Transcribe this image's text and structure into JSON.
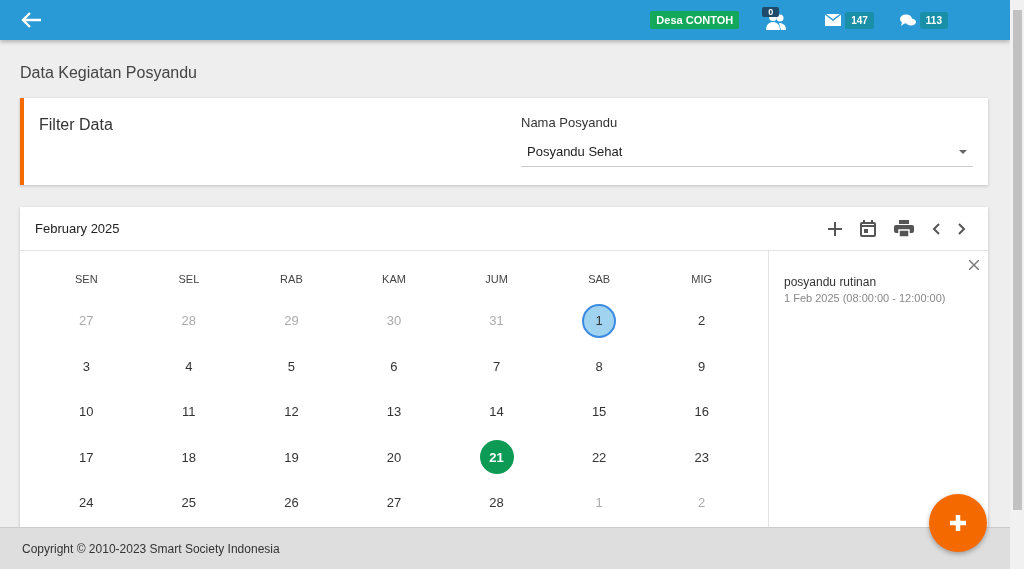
{
  "header": {
    "village_badge": "Desa CONTOH",
    "users_count": "0",
    "messages_count": "147",
    "comments_count": "113"
  },
  "page_title": "Data Kegiatan Posyandu",
  "filter": {
    "title": "Filter Data",
    "field_label": "Nama Posyandu",
    "value": "Posyandu Sehat"
  },
  "calendar": {
    "month": "February 2025",
    "weekdays": [
      "SEN",
      "SEL",
      "RAB",
      "KAM",
      "JUM",
      "SAB",
      "MIG"
    ],
    "days": [
      {
        "label": "27",
        "muted": true,
        "selected": false,
        "today": false
      },
      {
        "label": "28",
        "muted": true,
        "selected": false,
        "today": false
      },
      {
        "label": "29",
        "muted": true,
        "selected": false,
        "today": false
      },
      {
        "label": "30",
        "muted": true,
        "selected": false,
        "today": false
      },
      {
        "label": "31",
        "muted": true,
        "selected": false,
        "today": false
      },
      {
        "label": "1",
        "muted": false,
        "selected": true,
        "today": false
      },
      {
        "label": "2",
        "muted": false,
        "selected": false,
        "today": false
      },
      {
        "label": "3",
        "muted": false,
        "selected": false,
        "today": false
      },
      {
        "label": "4",
        "muted": false,
        "selected": false,
        "today": false
      },
      {
        "label": "5",
        "muted": false,
        "selected": false,
        "today": false
      },
      {
        "label": "6",
        "muted": false,
        "selected": false,
        "today": false
      },
      {
        "label": "7",
        "muted": false,
        "selected": false,
        "today": false
      },
      {
        "label": "8",
        "muted": false,
        "selected": false,
        "today": false
      },
      {
        "label": "9",
        "muted": false,
        "selected": false,
        "today": false
      },
      {
        "label": "10",
        "muted": false,
        "selected": false,
        "today": false
      },
      {
        "label": "11",
        "muted": false,
        "selected": false,
        "today": false
      },
      {
        "label": "12",
        "muted": false,
        "selected": false,
        "today": false
      },
      {
        "label": "13",
        "muted": false,
        "selected": false,
        "today": false
      },
      {
        "label": "14",
        "muted": false,
        "selected": false,
        "today": false
      },
      {
        "label": "15",
        "muted": false,
        "selected": false,
        "today": false
      },
      {
        "label": "16",
        "muted": false,
        "selected": false,
        "today": false
      },
      {
        "label": "17",
        "muted": false,
        "selected": false,
        "today": false
      },
      {
        "label": "18",
        "muted": false,
        "selected": false,
        "today": false
      },
      {
        "label": "19",
        "muted": false,
        "selected": false,
        "today": false
      },
      {
        "label": "20",
        "muted": false,
        "selected": false,
        "today": false
      },
      {
        "label": "21",
        "muted": false,
        "selected": false,
        "today": true
      },
      {
        "label": "22",
        "muted": false,
        "selected": false,
        "today": false
      },
      {
        "label": "23",
        "muted": false,
        "selected": false,
        "today": false
      },
      {
        "label": "24",
        "muted": false,
        "selected": false,
        "today": false
      },
      {
        "label": "25",
        "muted": false,
        "selected": false,
        "today": false
      },
      {
        "label": "26",
        "muted": false,
        "selected": false,
        "today": false
      },
      {
        "label": "27",
        "muted": false,
        "selected": false,
        "today": false
      },
      {
        "label": "28",
        "muted": false,
        "selected": false,
        "today": false
      },
      {
        "label": "1",
        "muted": true,
        "selected": false,
        "today": false
      },
      {
        "label": "2",
        "muted": true,
        "selected": false,
        "today": false
      }
    ],
    "event": {
      "title": "posyandu rutinan",
      "time": "1 Feb 2025 (08:00:00 - 12:00:00)"
    }
  },
  "footer": "Copyright © 2010-2023 Smart Society Indonesia"
}
